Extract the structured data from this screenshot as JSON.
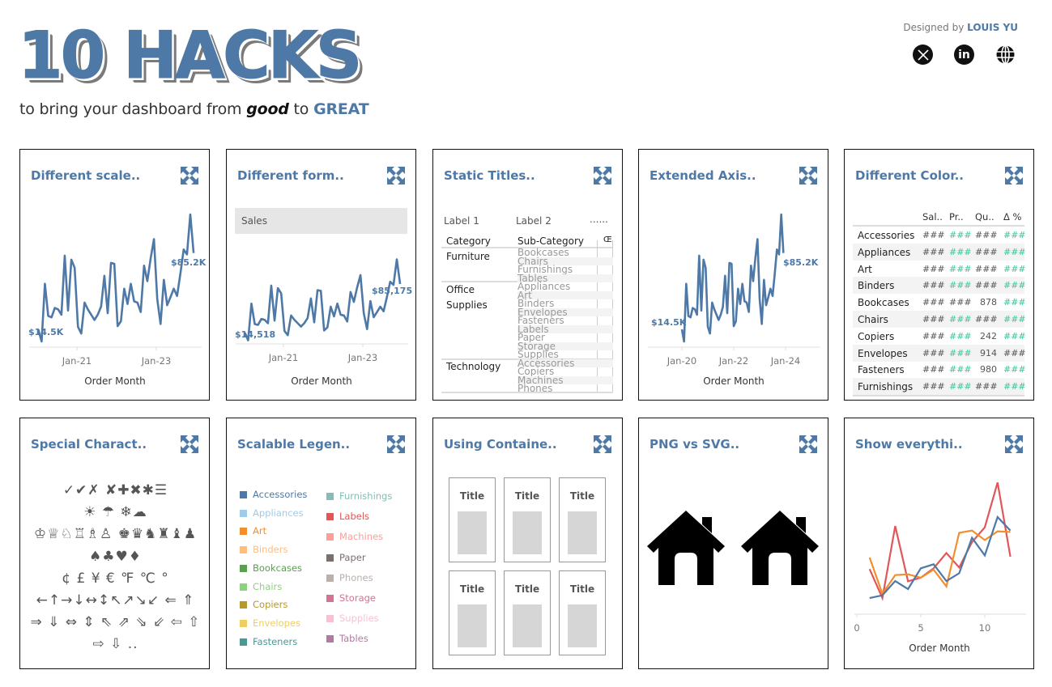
{
  "header": {
    "title": "10 HACKS",
    "subtitle_pre": "to bring your dashboard from ",
    "subtitle_good": "good",
    "subtitle_mid": " to ",
    "subtitle_great": "GREAT",
    "credit_pre": "Designed by ",
    "credit_name": "LOUIS YU",
    "social": [
      "x-icon",
      "linkedin-icon",
      "globe-icon"
    ]
  },
  "colors": {
    "accent": "#4e79a7",
    "green": "#3cc49a",
    "text": "#333333"
  },
  "cards": [
    {
      "title": "Different scale..",
      "xlabel": "Order Month",
      "ticks": [
        "Jan-21",
        "Jan-23"
      ],
      "min_label": "$14.5K",
      "max_label": "$85.2K"
    },
    {
      "title": "Different form..",
      "xlabel": "Order Month",
      "ticks": [
        "Jan-21",
        "Jan-23"
      ],
      "header": "Sales",
      "min_label": "$14,518",
      "max_label": "$85,175"
    },
    {
      "title": "Static Titles.."
    },
    {
      "title": "Extended Axis..",
      "xlabel": "Order Month",
      "ticks": [
        "Jan-20",
        "Jan-22",
        "Jan-24"
      ],
      "min_label": "$14.5K",
      "max_label": "$85.2K"
    },
    {
      "title": "Different Color.."
    },
    {
      "title": "Special Charact.."
    },
    {
      "title": "Scalable Legen.."
    },
    {
      "title": "Using Containe.."
    },
    {
      "title": "PNG vs SVG.."
    },
    {
      "title": "Show everythi..",
      "xlabel": "Order Month",
      "ticks": [
        "0",
        "5",
        "10"
      ]
    }
  ],
  "chart_data": [
    {
      "type": "line",
      "title": "Different scale..",
      "xlabel": "Order Month",
      "x_start": "2020-01",
      "x_step": "month",
      "ylim": [
        10,
        120
      ],
      "xlim": [
        "2019-11",
        "2024-02"
      ],
      "values": [
        24.2,
        14.5,
        60.6,
        34.9,
        33.8,
        41.3,
        40.2,
        35.9,
        83.1,
        39.2,
        79.9,
        73.4,
        26.3,
        20.9,
        45.6,
        40.2,
        36.0,
        31.7,
        36.0,
        42.4,
        67.0,
        37.1,
        77.3,
        76.6,
        26.8,
        30.7,
        56.7,
        44.5,
        60.6,
        46.6,
        45.6,
        38.1,
        75.1,
        62.7,
        80.9,
        96.3,
        48.4,
        28.5,
        63.8,
        43.5,
        49.9,
        56.7,
        50.9,
        68.7,
        88.0,
        84.1,
        116.0,
        85.2
      ],
      "annotations": [
        "$14.5K",
        "$85.2K"
      ]
    },
    {
      "type": "line",
      "title": "Different form..",
      "series_header": "Sales",
      "xlabel": "Order Month",
      "ylim": [
        10,
        120
      ],
      "annotations": [
        "$14,518",
        "$85,175"
      ]
    },
    {
      "type": "line",
      "title": "Extended Axis..",
      "xlabel": "Order Month",
      "xlim": [
        "2018-09",
        "2025-05"
      ],
      "ylim": [
        10,
        120
      ],
      "annotations": [
        "$14.5K",
        "$85.2K"
      ]
    },
    {
      "type": "line",
      "title": "Show everythi..",
      "xlabel": "Order Month",
      "xlim": [
        0,
        13
      ],
      "ylim": [
        0,
        100
      ],
      "x": [
        1,
        2,
        3,
        4,
        5,
        6,
        7,
        8,
        9,
        10,
        11,
        12
      ],
      "series": [
        {
          "color": "#4e79a7",
          "values": [
            12.2,
            14.3,
            25.1,
            19.0,
            34.7,
            37.8,
            25.1,
            31.0,
            57.8,
            44.5,
            73.5,
            63.3
          ]
        },
        {
          "color": "#f28e2b",
          "values": [
            42.9,
            15.3,
            29.6,
            30.2,
            27.6,
            33.7,
            21.0,
            61.6,
            63.3,
            56.1,
            62.7,
            62.2
          ]
        },
        {
          "color": "#e15759",
          "values": [
            34.1,
            12.2,
            66.7,
            24.9,
            27.6,
            34.7,
            46.3,
            35.3,
            54.5,
            65.7,
            99.6,
            43.5
          ]
        }
      ]
    }
  ],
  "static_titles": {
    "label1": "Label 1",
    "label2": "Label 2",
    "dots": "......",
    "col_category": "Category",
    "col_sub": "Sub-Category",
    "col_measure": "Œ",
    "groups": [
      {
        "name1": "Furniture",
        "name2": ""
      },
      {
        "name1": "Office",
        "name2": "Supplies"
      },
      {
        "name1": "Technology",
        "name2": ""
      }
    ],
    "subs": [
      "Bookcases",
      "Chairs",
      "Furnishings",
      "Tables",
      "Appliances",
      "Art",
      "Binders",
      "Envelopes",
      "Fasteners",
      "Labels",
      "Paper",
      "Storage",
      "Supplies",
      "Accessories",
      "Copiers",
      "Machines",
      "Phones"
    ]
  },
  "color_table": {
    "headers": [
      "Sal..",
      "Pr..",
      "Qu..",
      "Δ %"
    ],
    "rows": [
      {
        "name": "Accessories",
        "cells": [
          [
            "###",
            "g"
          ],
          [
            "###",
            "c"
          ],
          [
            "###",
            "g"
          ],
          [
            "###",
            "c"
          ]
        ]
      },
      {
        "name": "Appliances",
        "cells": [
          [
            "###",
            "g"
          ],
          [
            "###",
            "c"
          ],
          [
            "###",
            "g"
          ],
          [
            "###",
            "c"
          ]
        ]
      },
      {
        "name": "Art",
        "cells": [
          [
            "###",
            "g"
          ],
          [
            "###",
            "c"
          ],
          [
            "###",
            "g"
          ],
          [
            "###",
            "c"
          ]
        ]
      },
      {
        "name": "Binders",
        "cells": [
          [
            "###",
            "g"
          ],
          [
            "###",
            "c"
          ],
          [
            "###",
            "g"
          ],
          [
            "###",
            "c"
          ]
        ]
      },
      {
        "name": "Bookcases",
        "cells": [
          [
            "###",
            "g"
          ],
          [
            "###",
            "g"
          ],
          [
            "878",
            "g"
          ],
          [
            "###",
            "c"
          ]
        ]
      },
      {
        "name": "Chairs",
        "cells": [
          [
            "###",
            "g"
          ],
          [
            "###",
            "c"
          ],
          [
            "###",
            "g"
          ],
          [
            "###",
            "c"
          ]
        ]
      },
      {
        "name": "Copiers",
        "cells": [
          [
            "###",
            "g"
          ],
          [
            "###",
            "c"
          ],
          [
            "242",
            "g"
          ],
          [
            "###",
            "c"
          ]
        ]
      },
      {
        "name": "Envelopes",
        "cells": [
          [
            "###",
            "g"
          ],
          [
            "###",
            "c"
          ],
          [
            "914",
            "g"
          ],
          [
            "###",
            "g"
          ]
        ]
      },
      {
        "name": "Fasteners",
        "cells": [
          [
            "###",
            "g"
          ],
          [
            "###",
            "c"
          ],
          [
            "980",
            "g"
          ],
          [
            "###",
            "c"
          ]
        ]
      },
      {
        "name": "Furnishings",
        "cells": [
          [
            "###",
            "g"
          ],
          [
            "###",
            "c"
          ],
          [
            "###",
            "g"
          ],
          [
            "###",
            "c"
          ]
        ]
      }
    ]
  },
  "special_chars": [
    "✓✔✗ ✘✚✖✱☰",
    "☀ ☂ ❄☁",
    "♔♕♘♖♗♙ ♚♛♞♜♝♟",
    "♠♣♥♦",
    "¢ £ ¥ € ℉ ℃ °",
    "←↑→↓↔↕↖↗↘↙ ⇐ ⇑",
    "⇒ ⇓ ⇔ ⇕ ⇖ ⇗ ⇘ ⇙ ⇦ ⇧",
    "⇨ ⇩ .."
  ],
  "legend": [
    {
      "name": "Accessories",
      "color": "#4e79a7"
    },
    {
      "name": "Appliances",
      "color": "#a0cbe8"
    },
    {
      "name": "Art",
      "color": "#f28e2b"
    },
    {
      "name": "Binders",
      "color": "#ffbe7d"
    },
    {
      "name": "Bookcases",
      "color": "#59a14f"
    },
    {
      "name": "Chairs",
      "color": "#8cd17d"
    },
    {
      "name": "Copiers",
      "color": "#b6992d"
    },
    {
      "name": "Envelopes",
      "color": "#f1ce63"
    },
    {
      "name": "Fasteners",
      "color": "#499894"
    },
    {
      "name": "Furnishings",
      "color": "#86bcb6"
    },
    {
      "name": "Labels",
      "color": "#e15759"
    },
    {
      "name": "Machines",
      "color": "#ff9d9a"
    },
    {
      "name": "Paper",
      "color": "#79706e"
    },
    {
      "name": "Phones",
      "color": "#bab0ac"
    },
    {
      "name": "Storage",
      "color": "#d37295"
    },
    {
      "name": "Supplies",
      "color": "#fabfd2"
    },
    {
      "name": "Tables",
      "color": "#b07aa1"
    }
  ],
  "containers": {
    "box_title": "Title"
  },
  "png_svg": {
    "icons": [
      "house-icon-png",
      "house-icon-svg"
    ]
  }
}
